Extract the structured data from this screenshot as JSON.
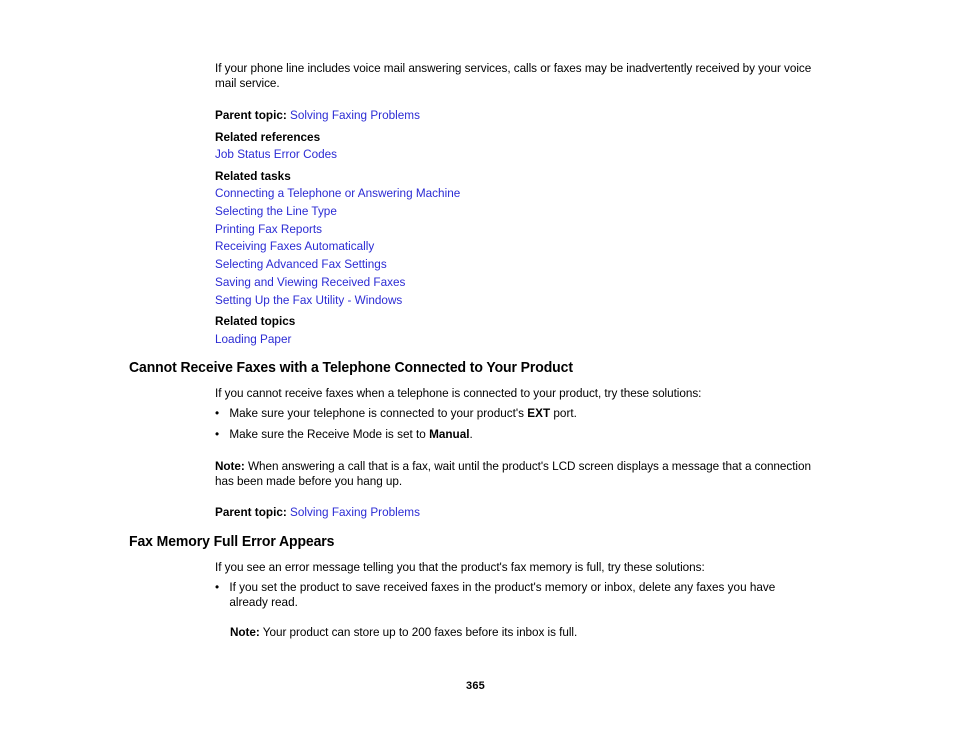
{
  "document": {
    "page_number": "365",
    "link_color": "#2b2bd4",
    "text_color": "#000000",
    "background_color": "#ffffff"
  },
  "intro_paragraph": "If your phone line includes voice mail answering services, calls or faxes may be inadvertently received by your voice mail service.",
  "section_one_refs": {
    "parent_topic_label": "Parent topic:",
    "parent_topic_link": "Solving Faxing Problems",
    "related_references_heading": "Related references",
    "related_references": [
      "Job Status Error Codes"
    ],
    "related_tasks_heading": "Related tasks",
    "related_tasks": [
      "Connecting a Telephone or Answering Machine",
      "Selecting the Line Type",
      "Printing Fax Reports",
      "Receiving Faxes Automatically",
      "Selecting Advanced Fax Settings",
      "Saving and Viewing Received Faxes",
      "Setting Up the Fax Utility - Windows"
    ],
    "related_topics_heading": "Related topics",
    "related_topics": [
      "Loading Paper"
    ]
  },
  "section_telephone": {
    "heading": "Cannot Receive Faxes with a Telephone Connected to Your Product",
    "intro": "If you cannot receive faxes when a telephone is connected to your product, try these solutions:",
    "bullets": [
      {
        "prefix": "Make sure your telephone is connected to your product's ",
        "bold": "EXT",
        "suffix": " port."
      },
      {
        "prefix": "Make sure the Receive Mode is set to ",
        "bold": "Manual",
        "suffix": "."
      }
    ],
    "note_label": "Note:",
    "note_text": " When answering a call that is a fax, wait until the product's LCD screen displays a message that a connection has been made before you hang up.",
    "parent_topic_label": "Parent topic:",
    "parent_topic_link": "Solving Faxing Problems"
  },
  "section_fax_memory": {
    "heading": "Fax Memory Full Error Appears",
    "intro": "If you see an error message telling you that the product's fax memory is full, try these solutions:",
    "bullets": [
      {
        "prefix": "If you set the product to save received faxes in the product's memory or inbox, delete any faxes you have already read.",
        "bold": "",
        "suffix": ""
      }
    ],
    "note_label": "Note:",
    "note_text": " Your product can store up to 200 faxes before its inbox is full."
  },
  "bullet_glyph": "•"
}
